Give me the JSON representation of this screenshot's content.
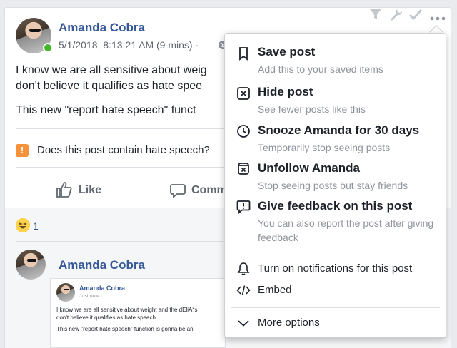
{
  "post": {
    "author": "Amanda Cobra",
    "timestamp": "5/1/2018, 8:13:21 AM (9 mins) ·",
    "text_line1": "I know we are all sensitive about weig",
    "text_line2": "don't believe it qualifies as hate spee",
    "text_line3": "This new \"report hate speech\" funct",
    "hate_question": "Does this post contain hate speech?",
    "like_label": "Like",
    "comment_label": "Comm",
    "reaction_count": "1"
  },
  "shared": {
    "author": "Amanda Cobra",
    "mini_author": "Amanda Cobra",
    "mini_meta": "Just now · ",
    "mini_line1": "I know we are all sensitive about weight and the dEliA*s",
    "mini_line2": "don't believe it qualifies as hate speech.",
    "mini_line3": "This new \"report hate speech\" function is gonna be an"
  },
  "menu": {
    "save_title": "Save post",
    "save_sub": "Add this to your saved items",
    "hide_title": "Hide post",
    "hide_sub": "See fewer posts like this",
    "snooze_title": "Snooze Amanda for 30 days",
    "snooze_sub": "Temporarily stop seeing posts",
    "unfollow_title": "Unfollow Amanda",
    "unfollow_sub": "Stop seeing posts but stay friends",
    "feedback_title": "Give feedback on this post",
    "feedback_sub": "You can also report the post after giving feedback",
    "notifications": "Turn on notifications for this post",
    "embed": "Embed",
    "more_options": "More options"
  },
  "icons": {
    "toolbar": [
      "filter-icon",
      "wrench-icon",
      "check-icon"
    ],
    "menu": [
      "bookmark-icon",
      "hide-x-icon",
      "clock-icon",
      "unfollow-icon",
      "feedback-icon",
      "bell-icon",
      "code-icon",
      "chevron-down-icon"
    ]
  },
  "colors": {
    "link": "#365899",
    "online": "#42b72a",
    "warning": "#f7923b",
    "muted": "#90949c"
  }
}
